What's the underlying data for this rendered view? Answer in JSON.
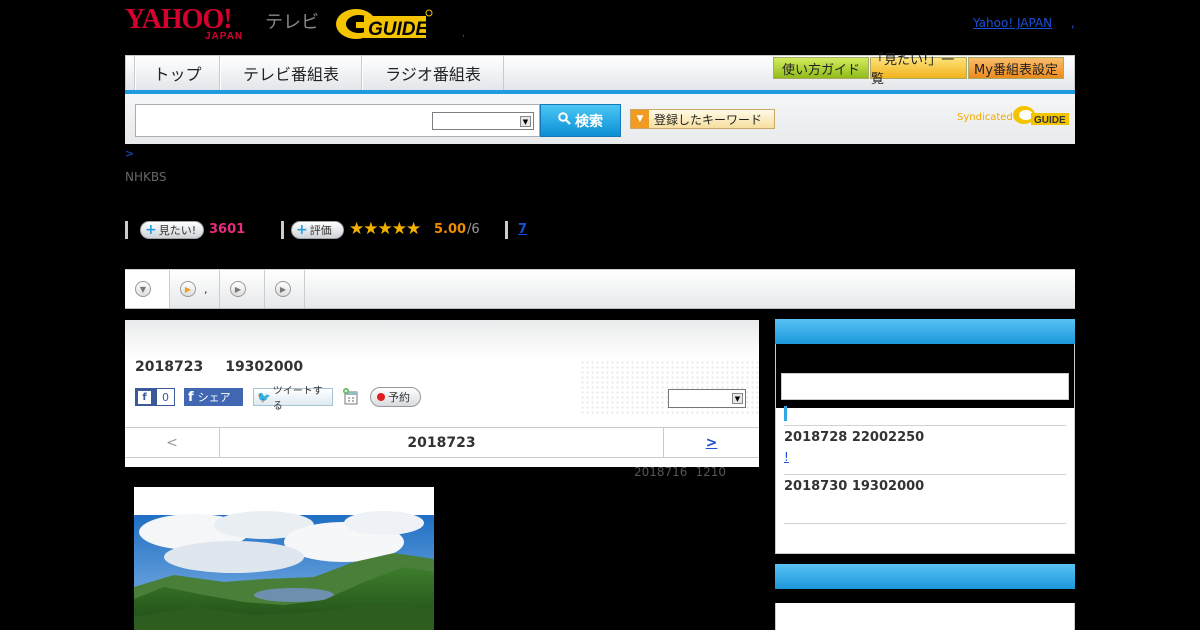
{
  "header": {
    "logo_main": "YAHOO!",
    "logo_sub": "JAPAN",
    "logo_tv": "テレビ",
    "logo_gguide": "GUIDE",
    "dot": ",",
    "yahoo_link": "Yahoo! JAPAN",
    "yahoo_link_dot": ","
  },
  "nav": {
    "tabs": [
      "トップ",
      "テレビ番組表",
      "ラジオ番組表"
    ],
    "right_buttons": [
      "使い方ガイド",
      "「見たい!」一覧",
      "My番組表設定"
    ]
  },
  "search": {
    "value": "",
    "select_value": "",
    "button_label": "検索",
    "keyword_button": "登録したキーワード",
    "syndicated": "Syndicated"
  },
  "program": {
    "breadcrumb": ">",
    "channel": "NHKBS"
  },
  "stats": {
    "want_label": "見たい!",
    "want_count": "3601",
    "rating_label": "評価",
    "stars": "★★★★★",
    "rating": "5.00",
    "rating_sub": "/6",
    "review_count": "7"
  },
  "tabs": [
    {
      "icon": "chevron-down-icon",
      "label": ""
    },
    {
      "icon": "play-icon",
      "label": ","
    },
    {
      "icon": "play-icon",
      "label": ""
    },
    {
      "icon": "play-icon",
      "label": ""
    }
  ],
  "main": {
    "air_date": "2018723",
    "air_time": "19302000",
    "fb_like_count": "0",
    "fb_share": "シェア",
    "tweet": "ツイートする",
    "reserve": "予約",
    "select_value": "",
    "prev": "<",
    "current_date": "2018723",
    "next": ">",
    "updated_date": "2018716",
    "updated_time": "1210"
  },
  "sidebar": {
    "items": [
      {
        "title": "2018728  22002250",
        "link": "!"
      },
      {
        "title": "2018730  19302000",
        "link": ""
      }
    ]
  },
  "colors": {
    "accent_blue": "#1f9be0",
    "link": "#1a4fd6",
    "want_pink": "#e62e7c",
    "star": "#f4b000"
  }
}
